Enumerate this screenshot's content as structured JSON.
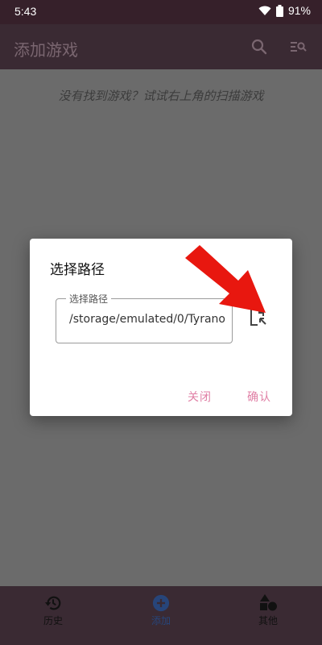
{
  "status": {
    "time": "5:43",
    "battery": "91%"
  },
  "appbar": {
    "title": "添加游戏",
    "icons": [
      "search-icon",
      "filter-search-icon"
    ]
  },
  "content": {
    "empty_hint": "没有找到游戏？试试右上角的扫描游戏"
  },
  "dialog": {
    "title": "选择路径",
    "field_label": "选择路径",
    "field_value": "/storage/emulated/0/Tyrano",
    "close_label": "关闭",
    "confirm_label": "确认",
    "accent_color": "#e07fa5"
  },
  "bottom_nav": [
    {
      "label": "历史",
      "icon": "history-icon"
    },
    {
      "label": "添加",
      "icon": "add-circle-icon"
    },
    {
      "label": "其他",
      "icon": "shapes-icon"
    }
  ]
}
